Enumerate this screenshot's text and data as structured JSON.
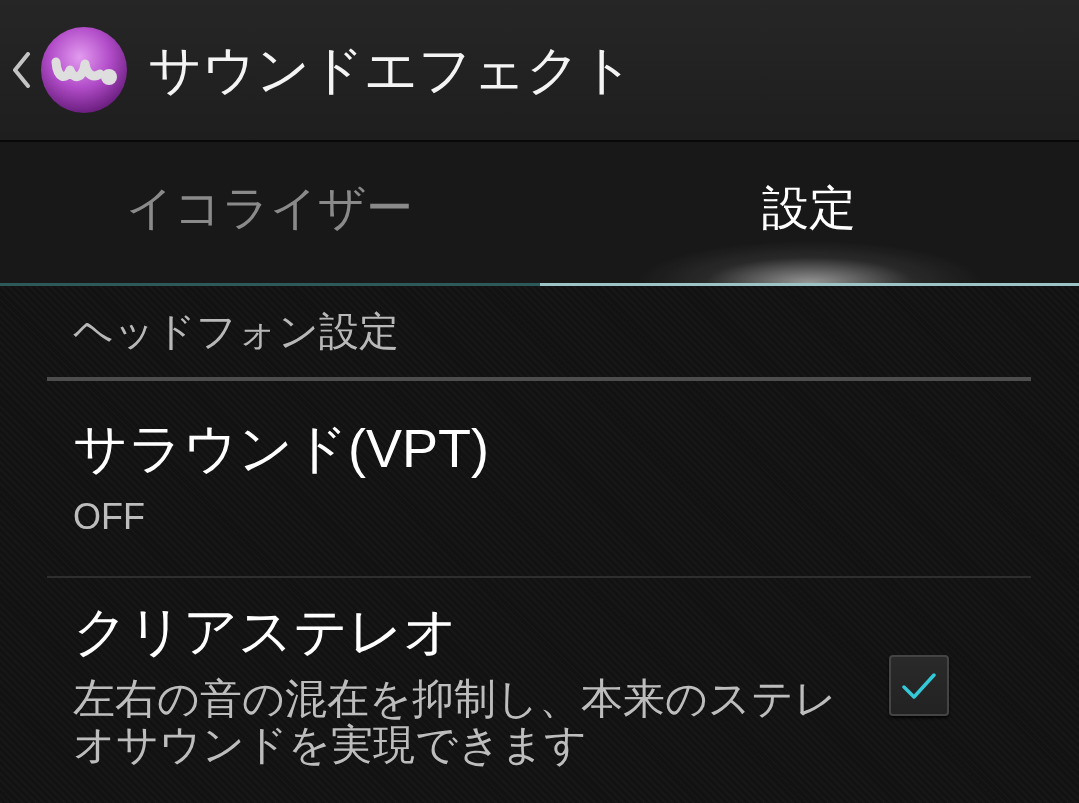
{
  "action_bar": {
    "title": "サウンドエフェクト"
  },
  "tabs": [
    {
      "label": "イコライザー",
      "selected": false
    },
    {
      "label": "設定",
      "selected": true
    }
  ],
  "sections": [
    {
      "header": "ヘッドフォン設定",
      "items": [
        {
          "kind": "value",
          "title": "サラウンド(VPT)",
          "summary": "OFF"
        },
        {
          "kind": "checkbox",
          "title": "クリアステレオ",
          "summary": "左右の音の混在を抑制し、本来のステレオサウンドを実現できます",
          "checked": true
        }
      ]
    }
  ]
}
